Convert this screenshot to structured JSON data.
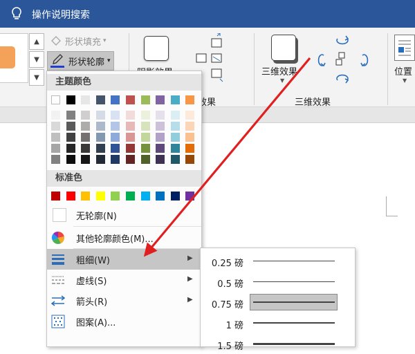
{
  "titlebar": {
    "title": "操作说明搜索"
  },
  "ribbon": {
    "shape_fill": "形状填充",
    "shape_outline": "形状轮廓",
    "shadow_effects": "阴影效果",
    "shadow_group_label": "效果",
    "threeD_effects": "三维效果",
    "threeD_group_label": "三维效果",
    "position": "位置"
  },
  "menu": {
    "theme_colors_label": "主题颜色",
    "theme_top": [
      "#ffffff",
      "#000000",
      "#e7e6e6",
      "#44546a",
      "#4472c4",
      "#c0504d",
      "#9bbb59",
      "#8064a2",
      "#4bacc6",
      "#f79646"
    ],
    "theme_shades": [
      [
        "#f2f2f2",
        "#808080",
        "#d0cece",
        "#d6dce5",
        "#d9e2f3",
        "#f2dcdb",
        "#ebf1dd",
        "#e5e0ec",
        "#dbeef3",
        "#fdeada"
      ],
      [
        "#d9d9d9",
        "#595959",
        "#aeabab",
        "#adb9ca",
        "#b4c6e7",
        "#e6b9b8",
        "#d7e3bc",
        "#ccc1d9",
        "#b7dde8",
        "#fbd5b5"
      ],
      [
        "#bfbfbf",
        "#404040",
        "#757171",
        "#8497b0",
        "#8eaadb",
        "#d99694",
        "#c3d69b",
        "#b2a1c7",
        "#92cddc",
        "#fac08f"
      ],
      [
        "#a6a6a6",
        "#262626",
        "#3b3838",
        "#323f4f",
        "#2f5496",
        "#953734",
        "#76923c",
        "#5f497a",
        "#31859b",
        "#e36c09"
      ],
      [
        "#808080",
        "#0d0d0d",
        "#171616",
        "#222a35",
        "#1f3864",
        "#632423",
        "#4f6128",
        "#3f3151",
        "#205867",
        "#974806"
      ]
    ],
    "standard_colors_label": "标准色",
    "standard": [
      "#c00000",
      "#ff0000",
      "#ffc000",
      "#ffff00",
      "#92d050",
      "#00b050",
      "#00b0f0",
      "#0070c0",
      "#002060",
      "#7030a0"
    ],
    "no_outline": "无轮廓(N)",
    "more_colors": "其他轮廓颜色(M)...",
    "weight": "粗细(W)",
    "dashes": "虚线(S)",
    "arrows": "箭头(R)",
    "pattern": "图案(A)..."
  },
  "weights": [
    {
      "label": "0.25 磅",
      "pt": 0.25
    },
    {
      "label": "0.5 磅",
      "pt": 0.5
    },
    {
      "label": "0.75 磅",
      "pt": 0.75,
      "selected": true
    },
    {
      "label": "1 磅",
      "pt": 1
    },
    {
      "label": "1.5 磅",
      "pt": 1.5
    }
  ],
  "colors": {
    "titlebar": "#2b579a",
    "highlight": "#c6c6c6",
    "arrow": "#e02020",
    "outline_pen": "#1f3fd1"
  }
}
